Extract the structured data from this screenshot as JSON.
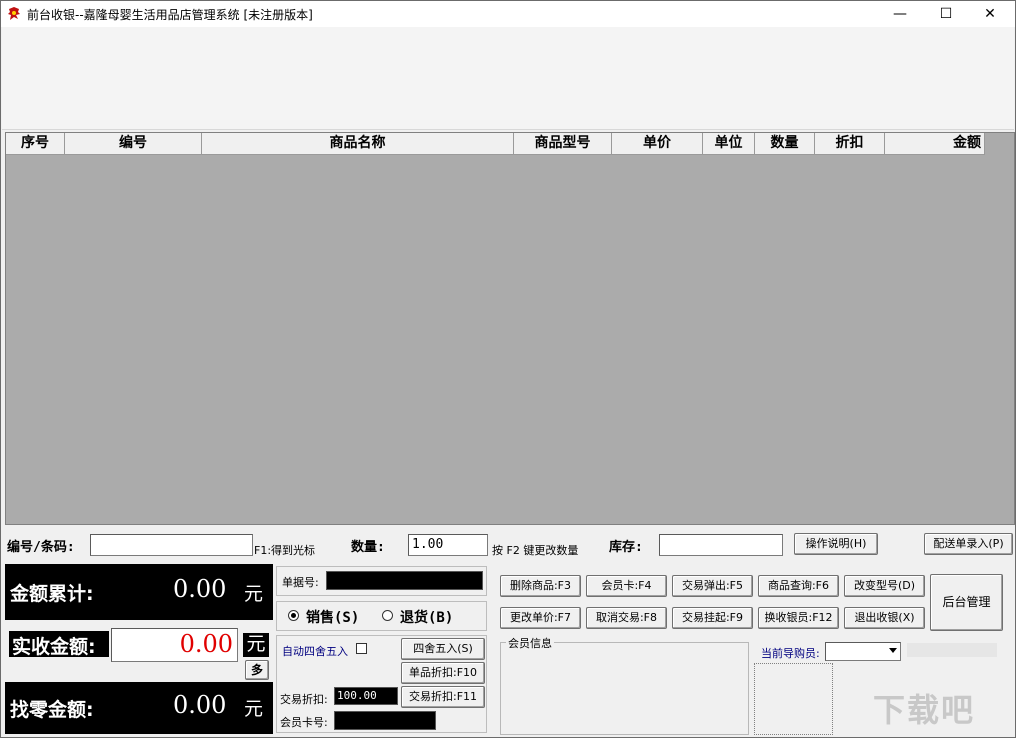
{
  "window": {
    "title": "前台收银--嘉隆母婴生活用品店管理系统 [未注册版本]",
    "minimize_glyph": "—",
    "maximize_glyph": "☐",
    "close_glyph": "✕"
  },
  "grid": {
    "columns": [
      "序号",
      "编号",
      "商品名称",
      "商品型号",
      "单价",
      "单位",
      "数量",
      "折扣",
      "金额"
    ]
  },
  "entry": {
    "code_label": "编号/条码:",
    "code_value": "",
    "f1_hint": "F1:得到光标",
    "qty_label": "数量:",
    "qty_value": "1.00",
    "f2_hint": "按 F2 键更改数量",
    "stock_label": "库存:",
    "stock_value": "",
    "help_button": "操作说明(H)",
    "delivery_button": "配送单录入(P)"
  },
  "totals": {
    "sum_label": "金额累计:",
    "sum_value": "0.00",
    "received_label": "实收金额:",
    "received_value": "0.00",
    "change_label": "找零金额:",
    "change_value": "0.00",
    "unit": "元",
    "multi_button": "多"
  },
  "middle": {
    "receipt_label": "单据号:",
    "receipt_value": "",
    "sale_label": "销售(S)",
    "return_label": "退货(B)",
    "auto_round_label": "自动四舍五入",
    "round_button": "四舍五入(S)",
    "item_discount_button": "单品折扣:F10",
    "trade_discount_label": "交易折扣:",
    "trade_discount_value": "100.00",
    "trade_discount_button": "交易折扣:F11",
    "member_card_label": "会员卡号:",
    "member_card_value": ""
  },
  "actions": {
    "row1": [
      "删除商品:F3",
      "会员卡:F4",
      "交易弹出:F5",
      "商品查询:F6",
      "改变型号(D)"
    ],
    "row2": [
      "更改单价:F7",
      "取消交易:F8",
      "交易挂起:F9",
      "换收银员:F12",
      "退出收银(X)"
    ],
    "admin_button": "后台管理",
    "member_info_label": "会员信息",
    "shopping_guide_label": "当前导购员:",
    "shopping_guide_value": ""
  },
  "watermark": "下载吧",
  "colors": {
    "received_amount": "#e00000",
    "grid_bg": "#ababab",
    "blue_label": "#000080"
  }
}
